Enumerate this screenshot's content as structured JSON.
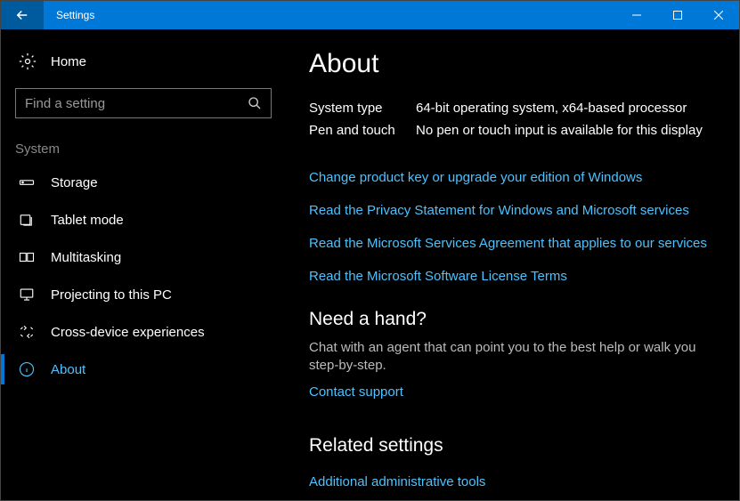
{
  "titlebar": {
    "title": "Settings"
  },
  "sidebar": {
    "home_label": "Home",
    "search_placeholder": "Find a setting",
    "section_label": "System",
    "items": [
      {
        "label": "Storage"
      },
      {
        "label": "Tablet mode"
      },
      {
        "label": "Multitasking"
      },
      {
        "label": "Projecting to this PC"
      },
      {
        "label": "Cross-device experiences"
      },
      {
        "label": "About"
      }
    ]
  },
  "main": {
    "title": "About",
    "info": [
      {
        "label": "System type",
        "value": "64-bit operating system, x64-based processor"
      },
      {
        "label": "Pen and touch",
        "value": "No pen or touch input is available for this display"
      }
    ],
    "links_top": [
      "Change product key or upgrade your edition of Windows",
      "Read the Privacy Statement for Windows and Microsoft services",
      "Read the Microsoft Services Agreement that applies to our services",
      "Read the Microsoft Software License Terms"
    ],
    "help_title": "Need a hand?",
    "help_body": "Chat with an agent that can point you to the best help or walk you step-by-step.",
    "help_link": "Contact support",
    "related_title": "Related settings",
    "related_link": "Additional administrative tools"
  }
}
